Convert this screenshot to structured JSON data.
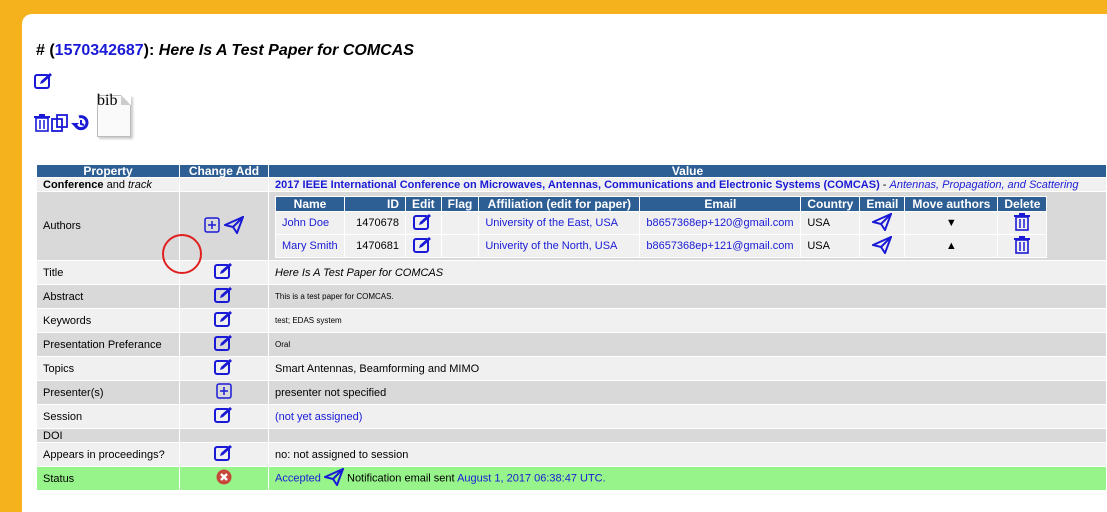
{
  "header": {
    "hash": "# (",
    "paper_id": "1570342687",
    "sep": "): ",
    "paper_title": "Here Is A Test Paper for COMCAS",
    "bib_label": "bib"
  },
  "table": {
    "headers": {
      "property": "Property",
      "change_add": "Change Add",
      "value": "Value"
    },
    "conference": {
      "prop_bold": "Conference",
      "prop_rest": " and ",
      "prop_italic": "track",
      "name": "2017 IEEE International Conference on Microwaves, Antennas, Communications and Electronic Systems (COMCAS)",
      "track_sep": " - ",
      "track": "Antennas, Propagation, and Scattering"
    },
    "authors_label": "Authors",
    "authors": {
      "headers": [
        "Name",
        "ID",
        "Edit",
        "Flag",
        "Affiliation (edit for paper)",
        "Email",
        "Country",
        "Email",
        "Move authors",
        "Delete"
      ],
      "rows": [
        {
          "name": "John Doe",
          "id": "1470678",
          "affiliation": "University of the East, USA",
          "email": "b8657368ep+120@gmail.com",
          "country": "USA",
          "move": "▼"
        },
        {
          "name": "Mary Smith",
          "id": "1470681",
          "affiliation": "Univerity of the North, USA",
          "email": "b8657368ep+121@gmail.com",
          "country": "USA",
          "move": "▲"
        }
      ]
    },
    "title": {
      "label": "Title",
      "value": "Here Is A Test Paper for COMCAS"
    },
    "abstract": {
      "label": "Abstract",
      "value": "This is a test paper for COMCAS."
    },
    "keywords": {
      "label": "Keywords",
      "value": "test; EDAS system"
    },
    "presentation": {
      "label": "Presentation Preferance",
      "value": "Oral"
    },
    "topics": {
      "label": "Topics",
      "value": "Smart Antennas, Beamforming and MIMO"
    },
    "presenter": {
      "label": "Presenter(s)",
      "value": "presenter not specified"
    },
    "session": {
      "label": "Session",
      "value": "(not yet assigned)"
    },
    "doi": {
      "label": "DOI",
      "value": ""
    },
    "proceedings": {
      "label": "Appears in proceedings?",
      "value": "no: not assigned to session"
    },
    "status": {
      "label": "Status",
      "accepted": "Accepted",
      "notification": " Notification email sent ",
      "date": "August 1, 2017 06:38:47 UTC."
    }
  },
  "colors": {
    "accent": "#2d5e94",
    "link": "#1a1ad6",
    "status_bg": "#97f48a",
    "frame": "#f5b21c"
  }
}
